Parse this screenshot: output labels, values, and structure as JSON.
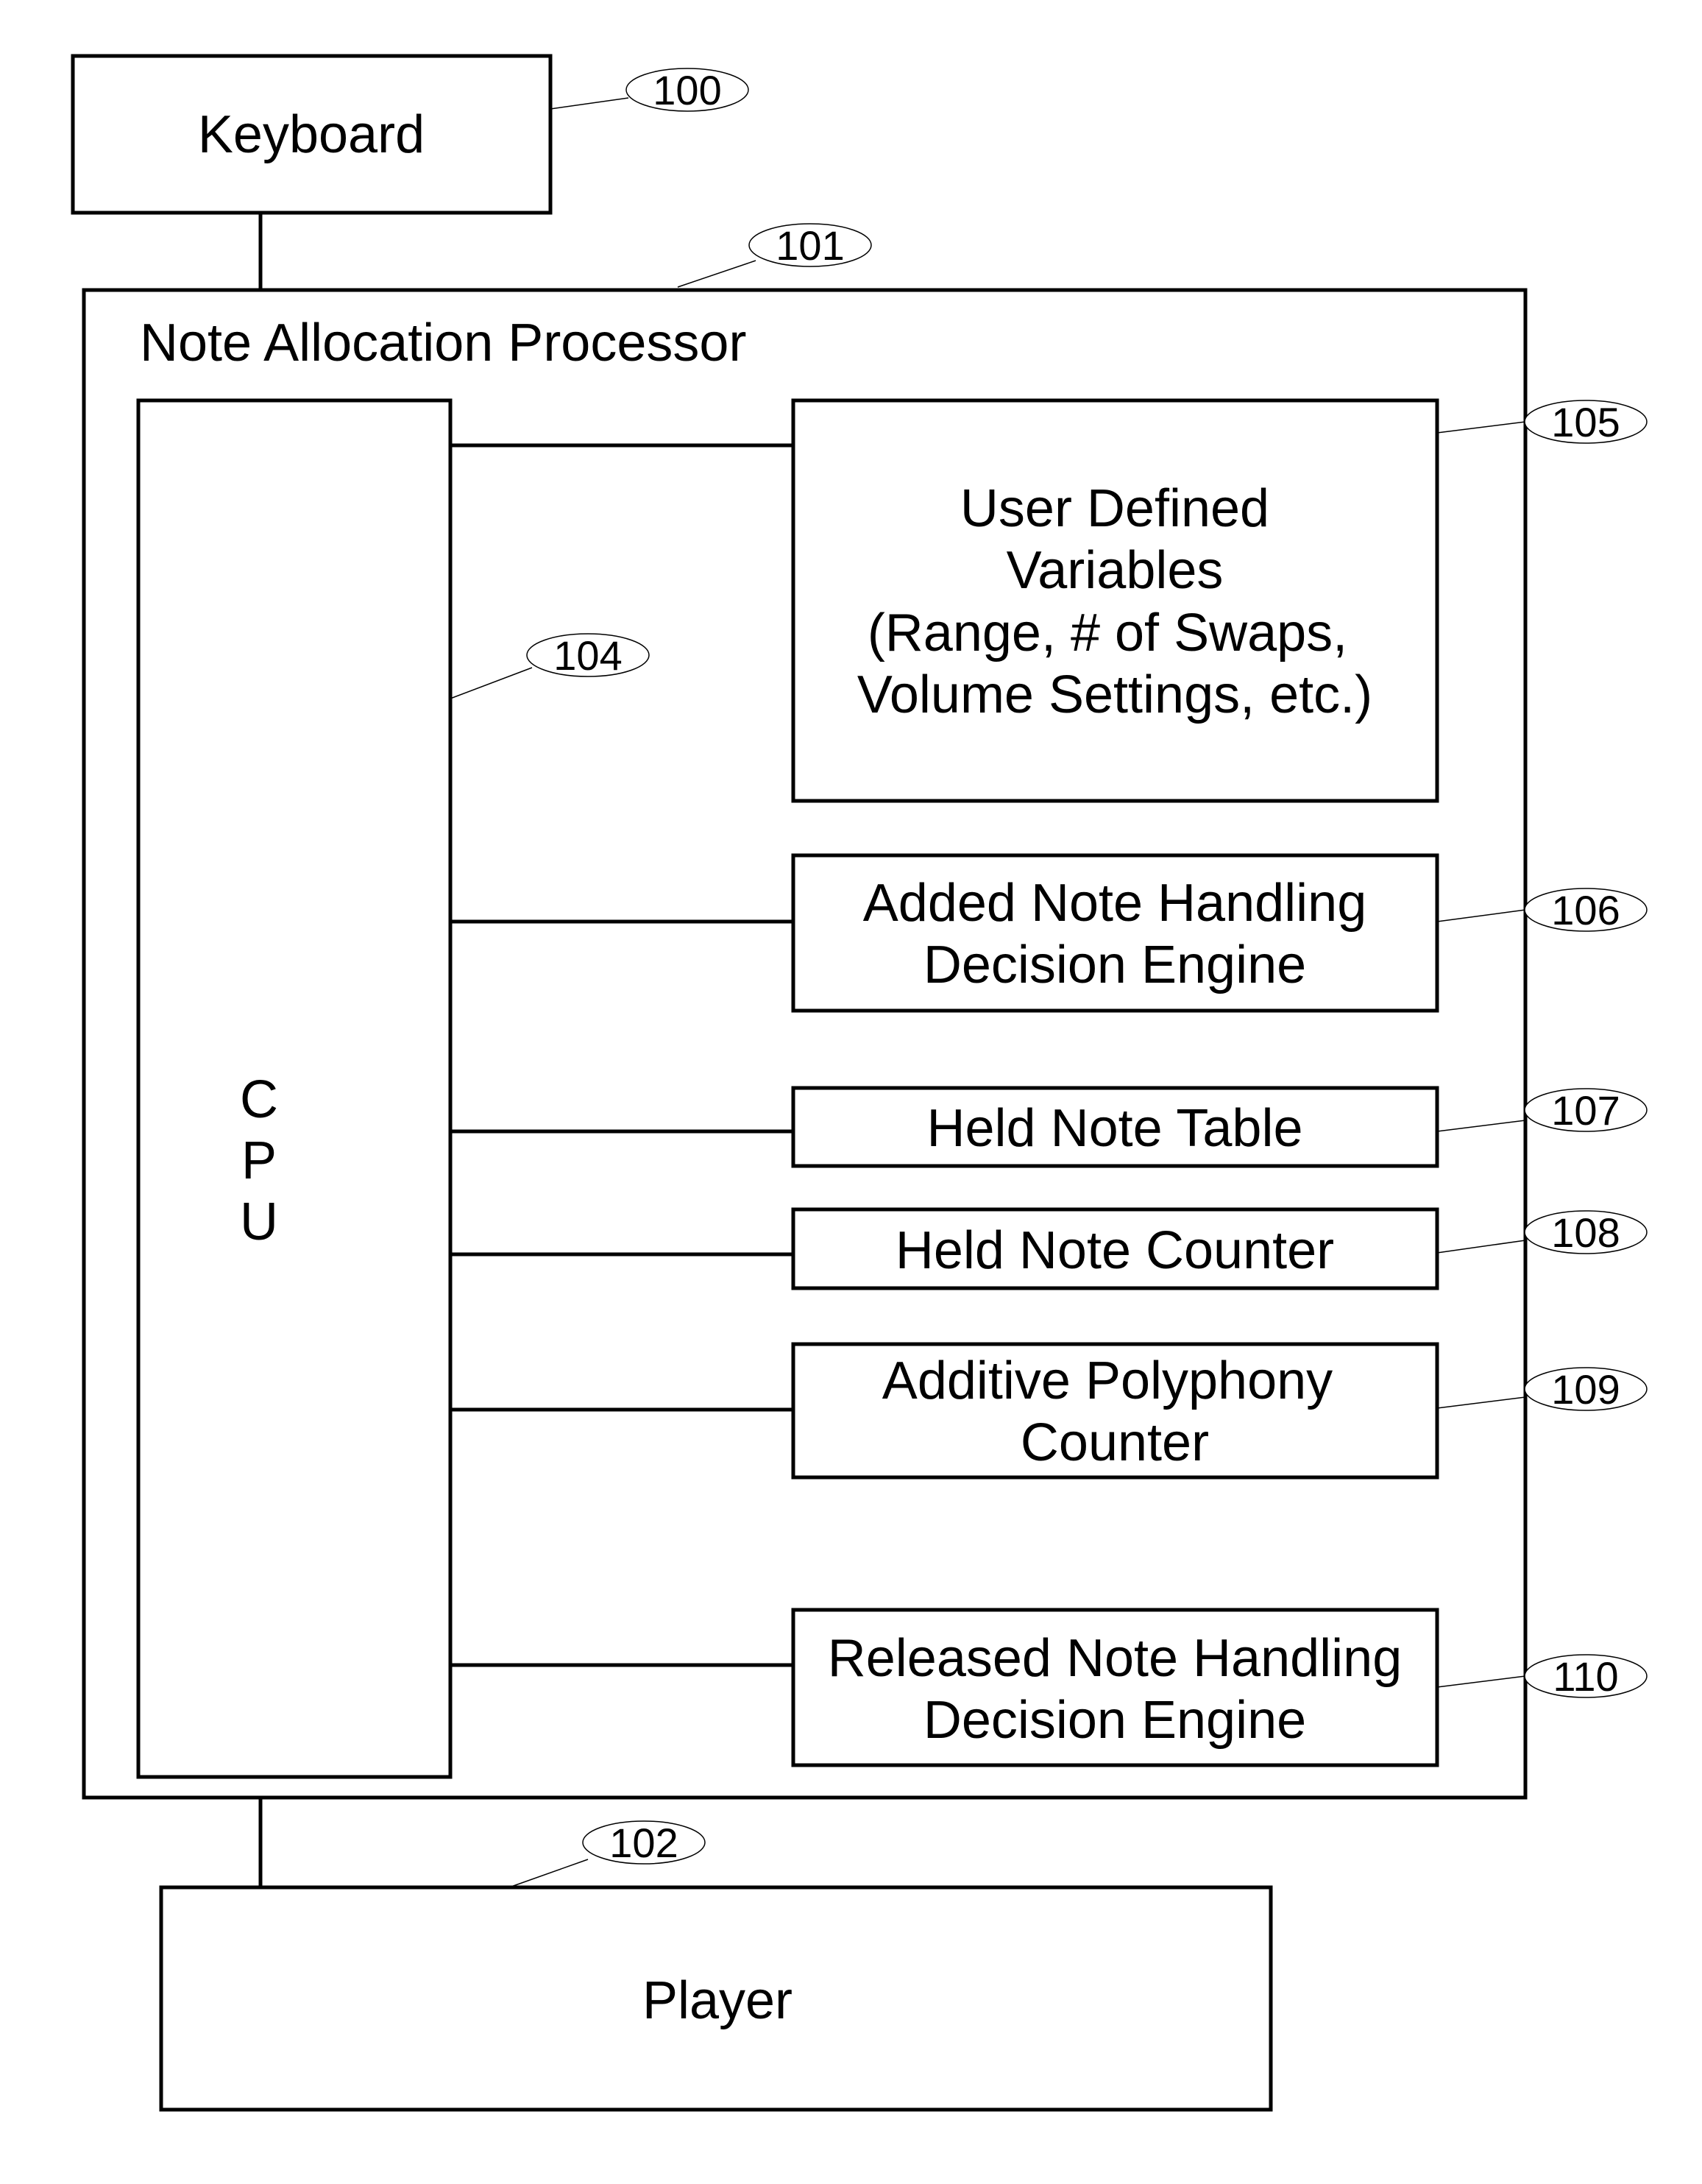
{
  "diagram": {
    "keyboard": {
      "label": "Keyboard",
      "ref": "100"
    },
    "processor": {
      "label": "Note Allocation Processor",
      "ref": "101"
    },
    "player": {
      "label": "Player",
      "ref": "102"
    },
    "cpu": {
      "letters": [
        "C",
        "P",
        "U"
      ],
      "ref": "104"
    },
    "modules": [
      {
        "lines": [
          "User Defined",
          "Variables",
          "(Range, # of Swaps,",
          "Volume Settings, etc.)"
        ],
        "ref": "105"
      },
      {
        "lines": [
          "Added Note Handling",
          "Decision Engine"
        ],
        "ref": "106"
      },
      {
        "lines": [
          "Held Note Table"
        ],
        "ref": "107"
      },
      {
        "lines": [
          "Held Note Counter"
        ],
        "ref": "108"
      },
      {
        "lines": [
          "Additive Polyphony",
          "Counter"
        ],
        "ref": "109"
      },
      {
        "lines": [
          "Released Note Handling",
          "Decision Engine"
        ],
        "ref": "110"
      }
    ]
  }
}
